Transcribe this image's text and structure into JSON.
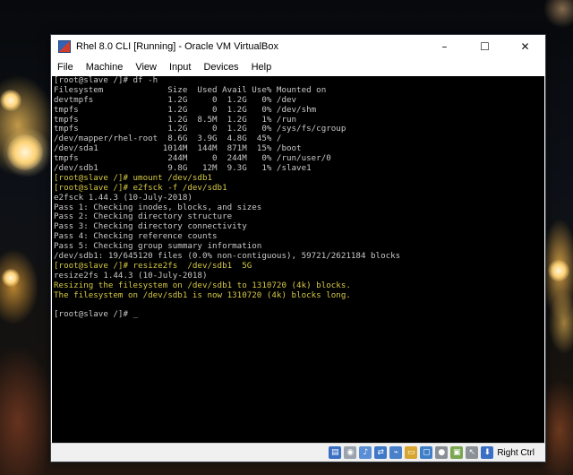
{
  "window": {
    "title": "Rhel 8.0 CLI [Running] - Oracle VM VirtualBox",
    "minimize_glyph": "–",
    "maximize_glyph": "☐",
    "close_glyph": "✕"
  },
  "menu": [
    "File",
    "Machine",
    "View",
    "Input",
    "Devices",
    "Help"
  ],
  "terminal": {
    "lines": [
      {
        "text": "[root@slave /]# df -h",
        "color": "white"
      },
      {
        "text": "Filesystem             Size  Used Avail Use% Mounted on",
        "color": "white"
      },
      {
        "text": "devtmpfs               1.2G     0  1.2G   0% /dev",
        "color": "white"
      },
      {
        "text": "tmpfs                  1.2G     0  1.2G   0% /dev/shm",
        "color": "white"
      },
      {
        "text": "tmpfs                  1.2G  8.5M  1.2G   1% /run",
        "color": "white"
      },
      {
        "text": "tmpfs                  1.2G     0  1.2G   0% /sys/fs/cgroup",
        "color": "white"
      },
      {
        "text": "/dev/mapper/rhel-root  8.6G  3.9G  4.8G  45% /",
        "color": "white"
      },
      {
        "text": "/dev/sda1             1014M  144M  871M  15% /boot",
        "color": "white"
      },
      {
        "text": "tmpfs                  244M     0  244M   0% /run/user/0",
        "color": "white"
      },
      {
        "text": "/dev/sdb1              9.8G   12M  9.3G   1% /slave1",
        "color": "white"
      },
      {
        "text": "[root@slave /]# umount /dev/sdb1",
        "color": "yellow"
      },
      {
        "text": "[root@slave /]# e2fsck -f /dev/sdb1",
        "color": "yellow"
      },
      {
        "text": "e2fsck 1.44.3 (10-July-2018)",
        "color": "white"
      },
      {
        "text": "Pass 1: Checking inodes, blocks, and sizes",
        "color": "white"
      },
      {
        "text": "Pass 2: Checking directory structure",
        "color": "white"
      },
      {
        "text": "Pass 3: Checking directory connectivity",
        "color": "white"
      },
      {
        "text": "Pass 4: Checking reference counts",
        "color": "white"
      },
      {
        "text": "Pass 5: Checking group summary information",
        "color": "white"
      },
      {
        "text": "/dev/sdb1: 19/645120 files (0.0% non-contiguous), 59721/2621184 blocks",
        "color": "white"
      },
      {
        "text": "[root@slave /]# resize2fs  /dev/sdb1  5G",
        "color": "yellow"
      },
      {
        "text": "resize2fs 1.44.3 (10-July-2018)",
        "color": "white"
      },
      {
        "text": "Resizing the filesystem on /dev/sdb1 to 1310720 (4k) blocks.",
        "color": "yellow"
      },
      {
        "text": "The filesystem on /dev/sdb1 is now 1310720 (4k) blocks long.",
        "color": "yellow"
      },
      {
        "text": "",
        "color": "white"
      },
      {
        "text": "[root@slave /]# _",
        "color": "white"
      }
    ],
    "colors": {
      "white": "#c8c8c8",
      "yellow": "#d6c844",
      "background": "#000000"
    }
  },
  "statusbar": {
    "icons": [
      {
        "name": "hard-disk-icon",
        "color": "#3a6fc4",
        "glyph": "▤"
      },
      {
        "name": "optical-drive-icon",
        "color": "#9aa3ad",
        "glyph": "◉"
      },
      {
        "name": "audio-icon",
        "color": "#5a8fd6",
        "glyph": "♪"
      },
      {
        "name": "network-icon",
        "color": "#3e78c8",
        "glyph": "⇄"
      },
      {
        "name": "usb-icon",
        "color": "#4a7fc9",
        "glyph": "⌁"
      },
      {
        "name": "shared-folder-icon",
        "color": "#d8a630",
        "glyph": "▭"
      },
      {
        "name": "display-icon",
        "color": "#3f7fc8",
        "glyph": "▢"
      },
      {
        "name": "video-capture-icon",
        "color": "#8a8f96",
        "glyph": "●"
      },
      {
        "name": "cpu-icon",
        "color": "#7aa652",
        "glyph": "▣"
      },
      {
        "name": "mouse-integration-icon",
        "color": "#8c9197",
        "glyph": "↖"
      },
      {
        "name": "keyboard-capture-icon",
        "color": "#3a6fc4",
        "glyph": "⬇"
      }
    ],
    "host_key": "Right Ctrl"
  }
}
